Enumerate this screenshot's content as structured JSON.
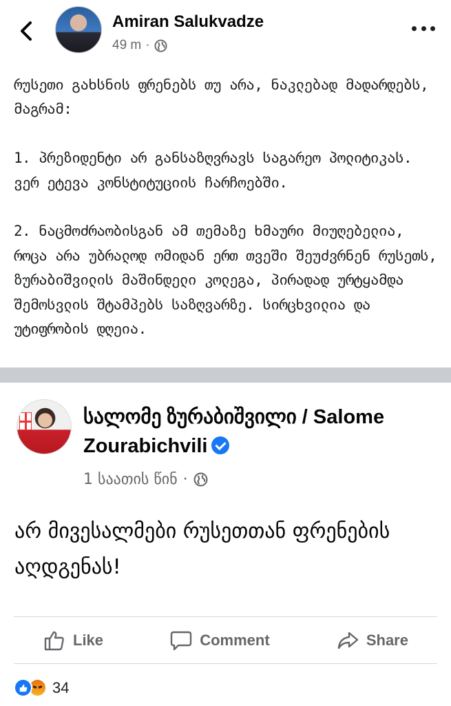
{
  "header": {
    "author": "Amiran Salukvadze",
    "time": "49 m",
    "separator": "·",
    "privacy_icon": "globe-icon",
    "back_icon": "chevron-left-icon",
    "more_icon": "more-dots-icon"
  },
  "post": {
    "text": "რუსეთი გახსნის ფრენებს თუ არა, ნაკლებად მადარდებს, მაგრამ:\n\n1. პრეზიდენტი არ განსაზღვრავს საგარეო პოლიტიკას. ვერ ეტევა კონსტიტუციის ჩარჩოებში.\n\n2. ნაცმოძრაობისგან ამ თემაზე ხმაური მიუღებელია, როცა არა უბრალოდ ომიდან ერთ თვეში შეუძვრნენ რუსეთს, ზურაბიშვილის მაშინდელი კოლეგა, პირადად ურტყამდა შემოსვლის შტამპებს საზღვარზე. სირცხვილია და უტიფრობის დღეია."
  },
  "shared": {
    "name": "სალომე ზურაბიშვილი / Salome Zourabichvili",
    "verified_icon": "verified-badge-icon",
    "time": "1 საათის წინ",
    "separator": "·",
    "privacy_icon": "globe-icon",
    "text": "არ მივესალმები რუსეთთან ფრენების აღდგენას!"
  },
  "actions": {
    "like": "Like",
    "comment": "Comment",
    "share": "Share"
  },
  "reactions": {
    "count": "34",
    "types": [
      "like",
      "angry"
    ]
  },
  "colors": {
    "accent": "#1877f2",
    "meta_text": "#65676b",
    "divider": "#c9ccd1"
  }
}
